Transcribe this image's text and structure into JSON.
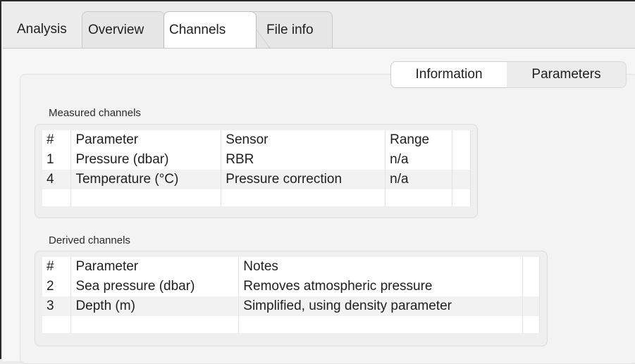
{
  "main_tabs": [
    {
      "label": "Analysis"
    },
    {
      "label": "Overview"
    },
    {
      "label": "Channels",
      "selected": true
    },
    {
      "label": "File info"
    }
  ],
  "sub_tabs": [
    {
      "label": "Information",
      "selected": true
    },
    {
      "label": "Parameters"
    }
  ],
  "measured": {
    "title": "Measured channels",
    "columns": [
      "#",
      "Parameter",
      "Sensor",
      "Range"
    ],
    "rows": [
      [
        "1",
        "Pressure (dbar)",
        "RBR",
        "n/a"
      ],
      [
        "4",
        "Temperature (°C)",
        "Pressure correction",
        "n/a"
      ]
    ]
  },
  "derived": {
    "title": "Derived channels",
    "columns": [
      "#",
      "Parameter",
      "Notes"
    ],
    "rows": [
      [
        "2",
        "Sea pressure (dbar)",
        "Removes atmospheric pressure"
      ],
      [
        "3",
        "Depth (m)",
        "Simplified, using density parameter"
      ]
    ]
  }
}
